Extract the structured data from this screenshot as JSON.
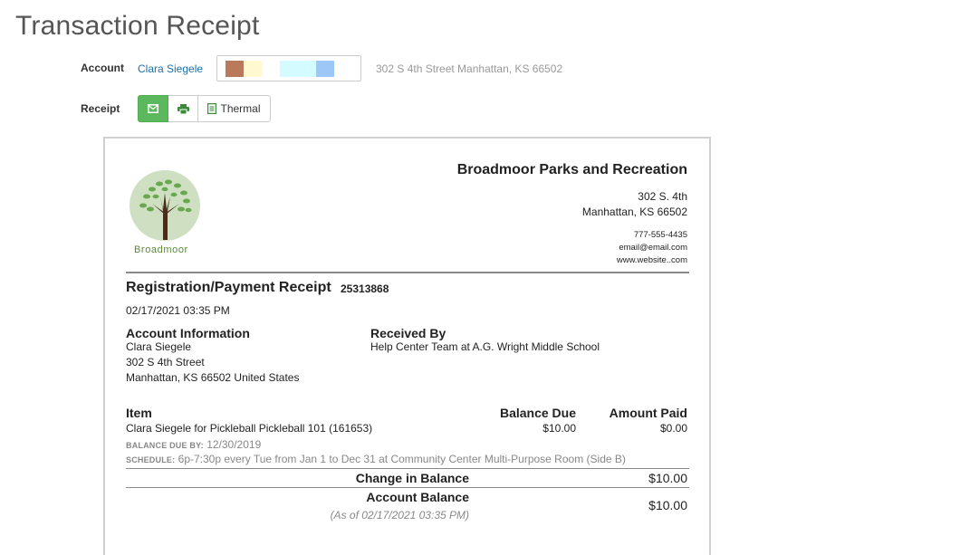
{
  "page": {
    "title": "Transaction Receipt"
  },
  "account": {
    "label": "Account",
    "name": "Clara Siegele",
    "address": "302 S 4th Street Manhattan, KS 66502",
    "swatches": [
      "#b87a5a",
      "#fff8d0",
      "#d4fbff",
      "#9cc7f7"
    ]
  },
  "receipt_controls": {
    "label": "Receipt",
    "email_icon": "envelope-icon",
    "print_icon": "printer-icon",
    "thermal_label": "Thermal",
    "thermal_icon": "document-icon",
    "accent_color": "#5cb85c"
  },
  "receipt": {
    "logo_text": "Broadmoor",
    "org_name": "Broadmoor Parks and Recreation",
    "org_address_line1": "302 S. 4th",
    "org_address_line2": "Manhattan, KS 66502",
    "phone": "777-555-4435",
    "email": "email@email.com",
    "website": "www.website..com",
    "title": "Registration/Payment Receipt",
    "number": "25313868",
    "date": "02/17/2021 03:35 PM",
    "account_info": {
      "heading": "Account Information",
      "name": "Clara Siegele",
      "street": "302 S 4th Street",
      "city": "Manhattan, KS 66502 United States"
    },
    "received_by": {
      "heading": "Received By",
      "value": "Help Center Team at A.G. Wright Middle School"
    },
    "items_table": {
      "headers": {
        "item": "Item",
        "balance_due": "Balance Due",
        "amount_paid": "Amount Paid"
      },
      "rows": [
        {
          "item": "Clara Siegele for Pickleball Pickleball 101 (161653)",
          "balance_due": "$10.00",
          "amount_paid": "$0.00",
          "balance_due_by_label": "BALANCE DUE BY:",
          "balance_due_by_value": "12/30/2019",
          "schedule_label": "SCHEDULE:",
          "schedule_value": "6p-7:30p every Tue from Jan 1 to Dec 31 at Community Center Multi-Purpose Room (Side B)"
        }
      ]
    },
    "change_in_balance": {
      "label": "Change in Balance",
      "value": "$10.00"
    },
    "account_balance": {
      "label": "Account Balance",
      "value": "$10.00",
      "as_of": "(As of 02/17/2021 03:35 PM)"
    }
  }
}
